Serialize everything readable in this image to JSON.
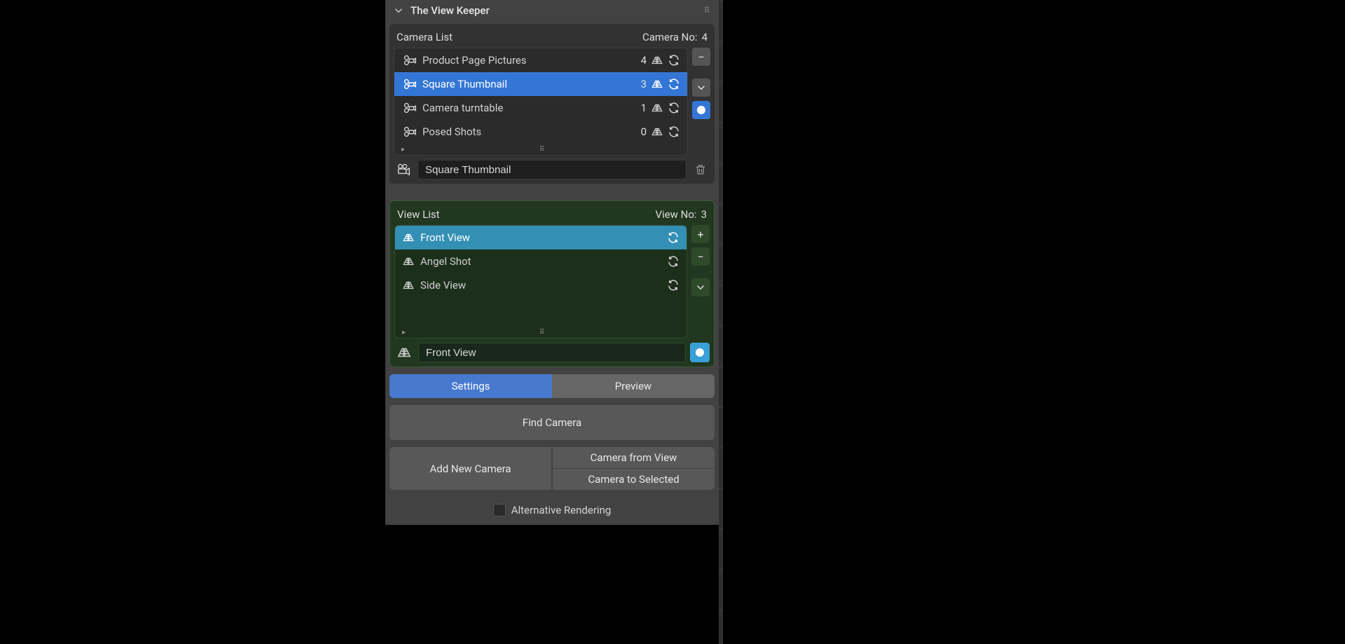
{
  "panel": {
    "title": "The View Keeper"
  },
  "camera": {
    "heading": "Camera List",
    "count_label": "Camera No:",
    "count": "4",
    "selected_name": "Square Thumbnail",
    "items": [
      {
        "name": "Product Page Pictures",
        "count": "4",
        "selected": false
      },
      {
        "name": "Square Thumbnail",
        "count": "3",
        "selected": true
      },
      {
        "name": "Camera turntable",
        "count": "1",
        "selected": false
      },
      {
        "name": "Posed Shots",
        "count": "0",
        "selected": false
      }
    ]
  },
  "view": {
    "heading": "View List",
    "count_label": "View No:",
    "count": "3",
    "selected_name": "Front View",
    "items": [
      {
        "name": "Front View",
        "selected": true
      },
      {
        "name": "Angel Shot",
        "selected": false
      },
      {
        "name": "Side View",
        "selected": false
      }
    ]
  },
  "tabs": {
    "settings": "Settings",
    "preview": "Preview"
  },
  "buttons": {
    "find_camera": "Find Camera",
    "add_new_camera": "Add New Camera",
    "camera_from_view": "Camera from View",
    "camera_to_sel": "Camera to Selected",
    "alt_rendering": "Alternative Rendering"
  }
}
